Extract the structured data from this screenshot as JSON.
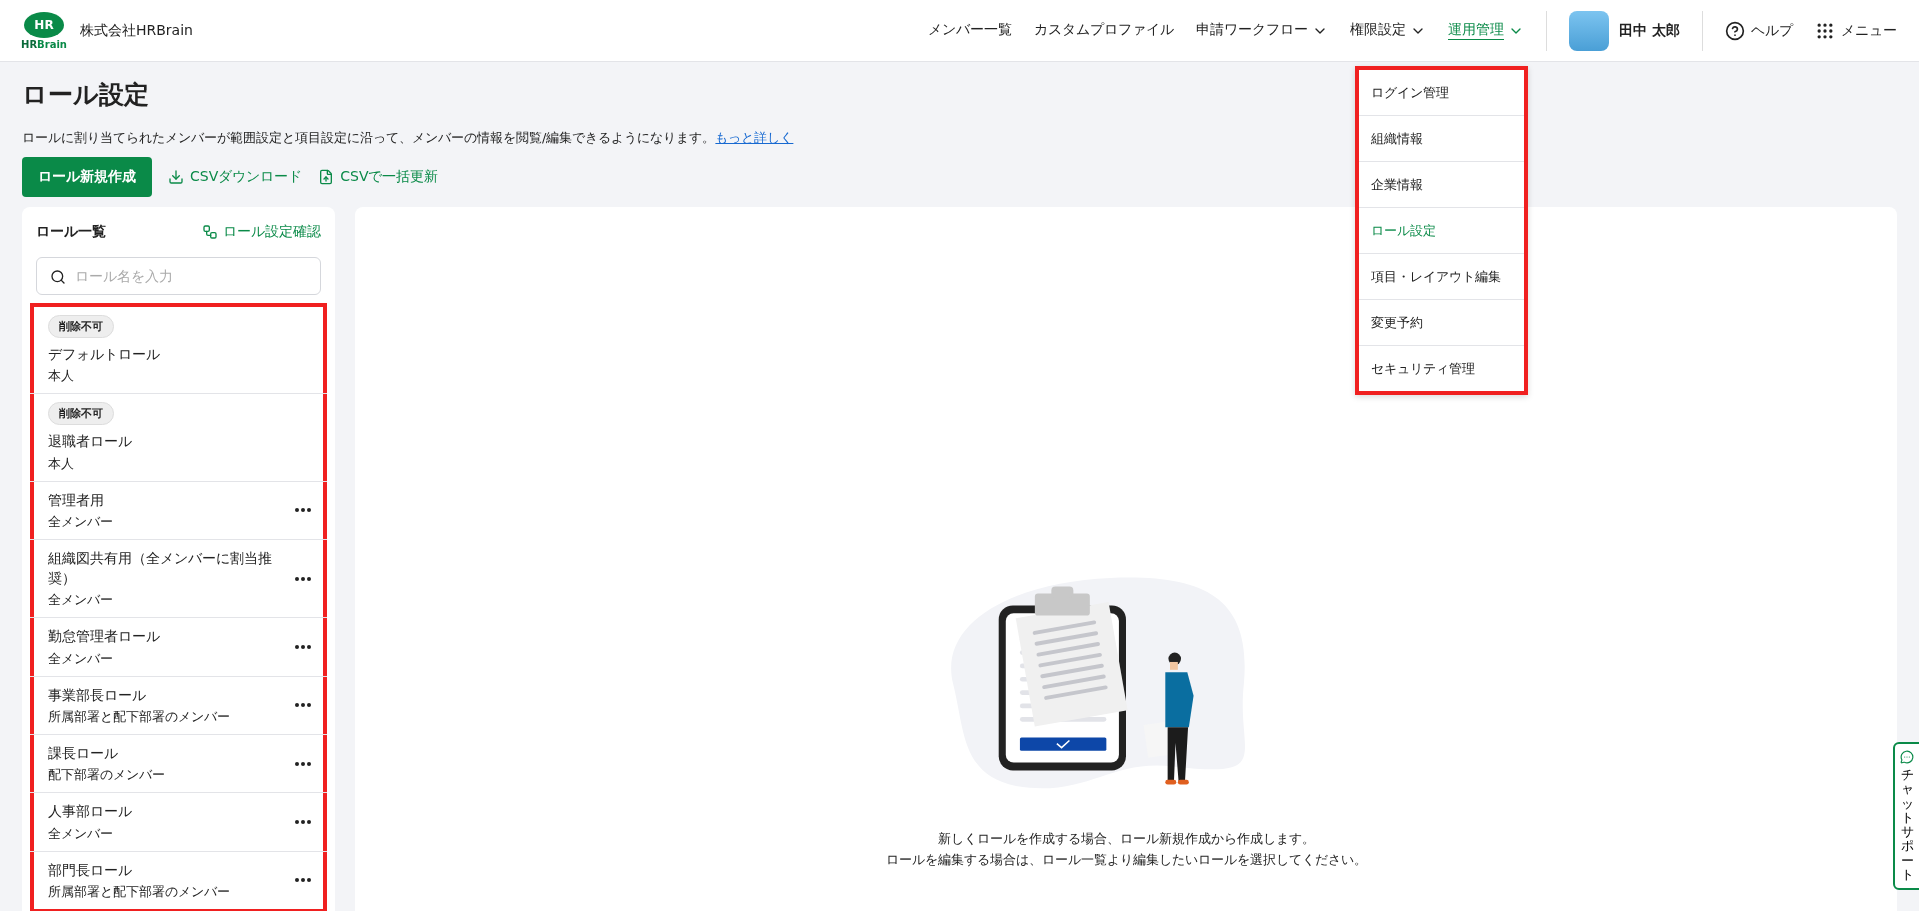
{
  "header": {
    "logo": {
      "mark": "HR",
      "wordmark_left": "HR",
      "wordmark_right": "Brain"
    },
    "company": "株式会社HRBrain",
    "nav": [
      {
        "label": "メンバー一覧",
        "kind": "link",
        "selected": false
      },
      {
        "label": "カスタムプロファイル",
        "kind": "link",
        "selected": false
      },
      {
        "label": "申請ワークフロー",
        "kind": "dropdown",
        "selected": false
      },
      {
        "label": "権限設定",
        "kind": "dropdown",
        "selected": false
      },
      {
        "label": "運用管理",
        "kind": "dropdown",
        "selected": true
      }
    ],
    "user": "田中 太郎",
    "help": "ヘルプ",
    "menu": "メニュー"
  },
  "dropdown": {
    "highlighted": true,
    "items": [
      {
        "label": "ログイン管理",
        "selected": false
      },
      {
        "label": "組織情報",
        "selected": false
      },
      {
        "label": "企業情報",
        "selected": false
      },
      {
        "label": "ロール設定",
        "selected": true
      },
      {
        "label": "項目・レイアウト編集",
        "selected": false
      },
      {
        "label": "変更予約",
        "selected": false
      },
      {
        "label": "セキュリティ管理",
        "selected": false
      }
    ]
  },
  "page": {
    "title": "ロール設定",
    "description": "ロールに割り当てられたメンバーが範囲設定と項目設定に沿って、メンバーの情報を閲覧/編集できるようになります。",
    "more_link": "もっと詳しく",
    "actions": [
      {
        "label": "ロール新規作成",
        "kind": "primary"
      },
      {
        "label": "CSVダウンロード",
        "kind": "download"
      },
      {
        "label": "CSVで一括更新",
        "kind": "upload"
      }
    ]
  },
  "role_panel": {
    "title": "ロール一覧",
    "confirm_link": "ロール設定確認",
    "search": {
      "placeholder": "ロール名を入力"
    },
    "highlighted": true,
    "roles": [
      {
        "badge": "削除不可",
        "name": "デフォルトロール",
        "scope": "本人",
        "has_menu": false
      },
      {
        "badge": "削除不可",
        "name": "退職者ロール",
        "scope": "本人",
        "has_menu": false
      },
      {
        "name": "管理者用",
        "scope": "全メンバー",
        "has_menu": true
      },
      {
        "name": "組織図共有用（全メンバーに割当推奨）",
        "scope": "全メンバー",
        "has_menu": true
      },
      {
        "name": "勤怠管理者ロール",
        "scope": "全メンバー",
        "has_menu": true
      },
      {
        "name": "事業部長ロール",
        "scope": "所属部署と配下部署のメンバー",
        "has_menu": true
      },
      {
        "name": "課長ロール",
        "scope": "配下部署のメンバー",
        "has_menu": true
      },
      {
        "name": "人事部ロール",
        "scope": "全メンバー",
        "has_menu": true
      },
      {
        "name": "部門長ロール",
        "scope": "所属部署と配下部署のメンバー",
        "has_menu": true
      }
    ]
  },
  "empty_state": {
    "lines": [
      "新しくロールを作成する場合、ロール新規作成から作成します。",
      "ロールを編集する場合は、ロール一覧より編集したいロールを選択してください。"
    ]
  },
  "chat_support": {
    "label": "チャットサポート"
  }
}
